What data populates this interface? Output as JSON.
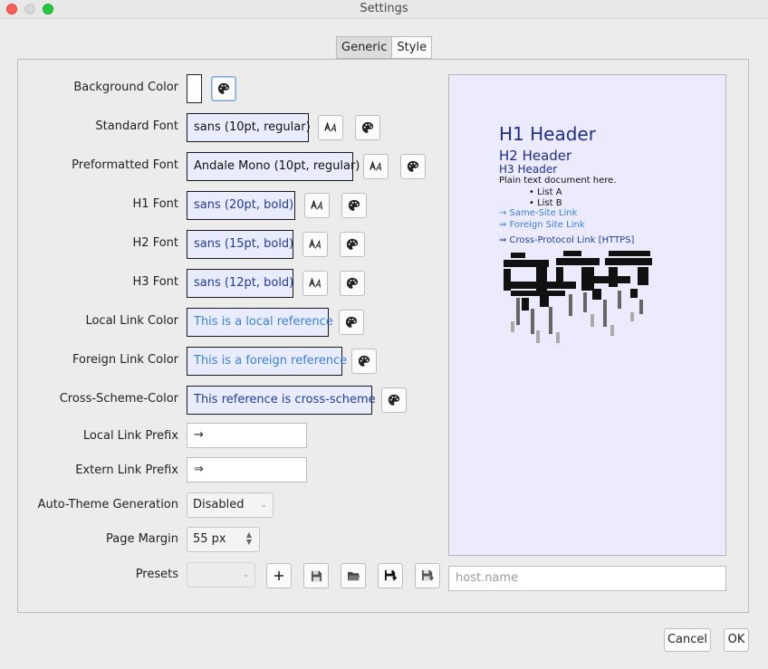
{
  "window": {
    "title": "Settings"
  },
  "tabs": [
    {
      "label": "Generic",
      "active": true
    },
    {
      "label": "Style",
      "active": false
    }
  ],
  "icons": {
    "palette": "palette-icon",
    "font": "font-icon",
    "plus": "plus-icon",
    "save": "save-icon",
    "open": "folder-open-icon",
    "save_as": "save-as-icon",
    "save_to": "save-to-icon"
  },
  "colors": {
    "header_navy": "#1f2f86",
    "link_blue": "#3a82d8",
    "cross_navy": "#1f3e9a",
    "preview_bg": "#ecebfd",
    "fontbox_bg": "#e9ecfd"
  },
  "form": {
    "background_color": {
      "label": "Background Color"
    },
    "standard_font": {
      "label": "Standard Font",
      "value": "sans (10pt, regular)"
    },
    "preformatted_font": {
      "label": "Preformatted Font",
      "value": "Andale Mono (10pt, regular)"
    },
    "h1_font": {
      "label": "H1 Font",
      "value": "sans (20pt, bold)"
    },
    "h2_font": {
      "label": "H2 Font",
      "value": "sans (15pt, bold)"
    },
    "h3_font": {
      "label": "H3 Font",
      "value": "sans (12pt, bold)"
    },
    "local_link_color": {
      "label": "Local Link Color",
      "value": "This is a local reference"
    },
    "foreign_link_color": {
      "label": "Foreign Link Color",
      "value": "This is a foreign reference"
    },
    "cross_scheme_color": {
      "label": "Cross-Scheme-Color",
      "value": "This reference is cross-scheme"
    },
    "local_link_prefix": {
      "label": "Local Link Prefix",
      "value": "→"
    },
    "extern_link_prefix": {
      "label": "Extern Link Prefix",
      "value": "⇒"
    },
    "auto_theme": {
      "label": "Auto-Theme Generation",
      "value": "Disabled"
    },
    "page_margin": {
      "label": "Page Margin",
      "value": "55 px"
    },
    "presets": {
      "label": "Presets",
      "value": "",
      "host_placeholder": "host.name"
    }
  },
  "preview": {
    "h1": "H1 Header",
    "h2": "H2 Header",
    "h3": "H3 Header",
    "paragraph": "Plain text document here.",
    "list": [
      "• List A",
      "• List B"
    ],
    "local_link": "→ Same-Site Link",
    "foreign_link": "⇒ Foreign Site Link",
    "cross_link": "⇒ Cross-Protocol Link [HTTPS]"
  },
  "dialog": {
    "cancel_label": "Cancel",
    "ok_label": "OK"
  }
}
